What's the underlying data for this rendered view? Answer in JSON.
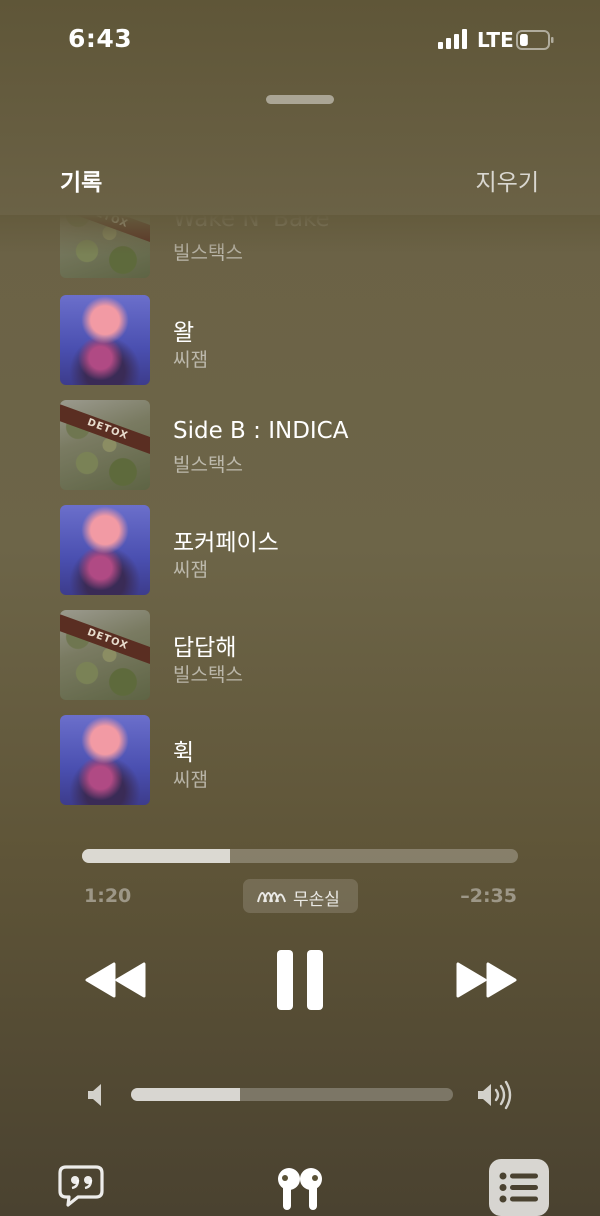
{
  "status": {
    "time": "6:43",
    "network": "LTE",
    "battery_level": 0.3
  },
  "header": {
    "title": "기록",
    "clear_label": "지우기"
  },
  "tracks": [
    {
      "title": "Wake N' Bake",
      "artist": "빌스택스",
      "cover": "detox-cover"
    },
    {
      "title": "왈",
      "artist": "씨잼",
      "cover": "ssijam-cover"
    },
    {
      "title": "Side B : INDICA",
      "artist": "빌스택스",
      "cover": "detox-cover"
    },
    {
      "title": "포커페이스",
      "artist": "씨잼",
      "cover": "ssijam-cover"
    },
    {
      "title": "답답해",
      "artist": "빌스택스",
      "cover": "detox-cover"
    },
    {
      "title": "휙",
      "artist": "씨잼",
      "cover": "ssijam-cover"
    }
  ],
  "playback": {
    "elapsed": "1:20",
    "remaining": "–2:35",
    "progress": 0.34,
    "quality_label": "무손실",
    "volume": 0.34
  },
  "cover_text": "DETOX",
  "icons": {
    "signal": "signal-bars-icon",
    "battery": "battery-icon",
    "lossless": "lossless-wave-icon",
    "rewind": "rewind-icon",
    "pause": "pause-icon",
    "forward": "fast-forward-icon",
    "volume_low": "speaker-low-icon",
    "volume_high": "speaker-high-icon",
    "lyrics": "quote-bubble-icon",
    "airpods": "airpods-icon",
    "queue": "queue-list-icon"
  },
  "colors": {
    "background": "#6b6246",
    "accent": "#ffffff"
  }
}
